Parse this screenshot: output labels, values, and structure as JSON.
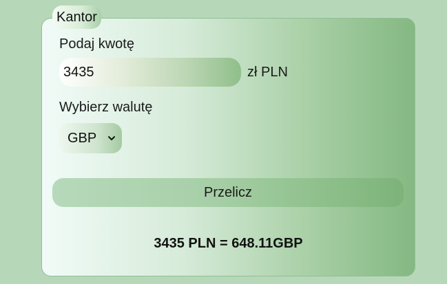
{
  "form": {
    "legend": "Kantor",
    "amount_label": "Podaj kwotę",
    "amount_value": "3435",
    "currency_unit": "zł PLN",
    "currency_label": "Wybierz walutę",
    "currency_selected": "GBP",
    "convert_label": "Przelicz",
    "result": "3435 PLN = 648.11GBP"
  },
  "icons": {
    "select_arrow": "chevron-down-icon"
  },
  "colors": {
    "background": "#b6d8b9",
    "card_border": "#8fbe93",
    "accent_green": "#7db37a"
  }
}
